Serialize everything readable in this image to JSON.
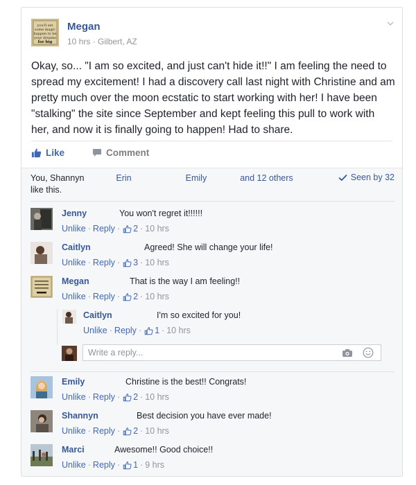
{
  "post": {
    "author": "Megan",
    "time": "10 hrs",
    "location": "Gilbert, AZ",
    "meta_sep": " · ",
    "avatar_text": [
      "you'll set",
      "some magic",
      "happen to be",
      "your dreams",
      "for big"
    ],
    "text": "Okay, so... \"I am so excited, and just can't hide it!!\" I am feeling the need to spread my excitement! I had a discovery call last night with Christine and am pretty much over the moon ecstatic to start working with her! I have been \"stalking\" the site since September and kept feeling this pull to work with her, and now it is finally going to happen! Had to share."
  },
  "actions": {
    "like": "Like",
    "comment": "Comment"
  },
  "likes": {
    "names": [
      "You",
      "Shannyn",
      "Erin",
      "Emily"
    ],
    "others": "and 12 others",
    "tail": "like this.",
    "seen": "Seen by 32"
  },
  "comments": [
    {
      "name": "Jenny",
      "text": "You won't regret it!!!!!!",
      "likes": "2",
      "time": "10 hrs"
    },
    {
      "name": "Caitlyn",
      "text": "Agreed! She will change your life!",
      "likes": "3",
      "time": "10 hrs"
    },
    {
      "name": "Megan",
      "text": "That is the way I am feeling!!",
      "likes": "2",
      "time": "10 hrs"
    },
    {
      "name": "Caitlyn",
      "text": "I'm so excited for you!",
      "likes": "1",
      "time": "10 hrs"
    },
    {
      "name": "Emily",
      "text": "Christine is the best!! Congrats!",
      "likes": "2",
      "time": "10 hrs"
    },
    {
      "name": "Shannyn",
      "text": "Best decision you have ever made!",
      "likes": "2",
      "time": "10 hrs"
    },
    {
      "name": "Marci",
      "text": "Awesome!! Good choice!!",
      "likes": "1",
      "time": "9 hrs"
    }
  ],
  "comment_actions": {
    "unlike": "Unlike",
    "reply": "Reply",
    "sep": " · "
  },
  "reply_box": {
    "placeholder": "Write a reply..."
  }
}
